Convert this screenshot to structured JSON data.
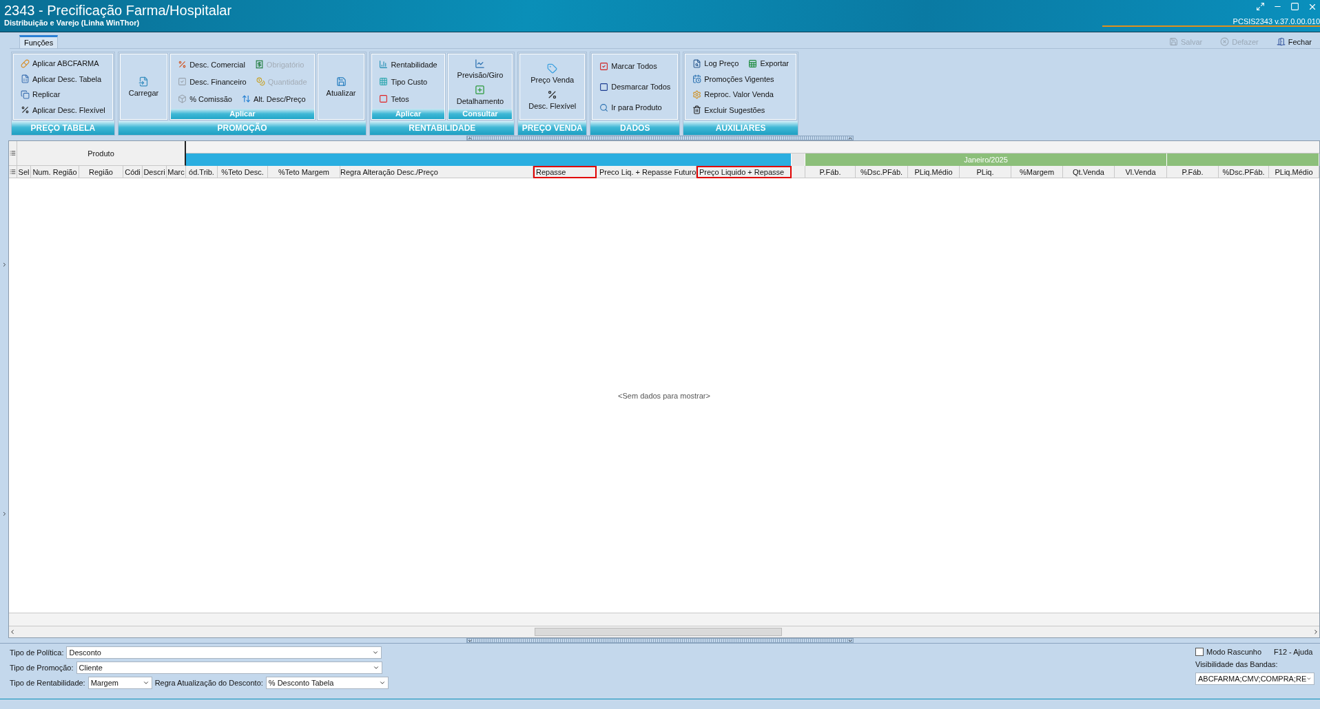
{
  "window": {
    "title": "2343 - Precificação Farma/Hospitalar",
    "subtitle": "Distribuição e Varejo (Linha WinThor)",
    "version": "PCSIS2343  v.37.0.00.010"
  },
  "toolbar": [
    {
      "label": "Salvar",
      "disabled": true
    },
    {
      "label": "Defazer",
      "disabled": true
    },
    {
      "label": "Fechar",
      "disabled": false
    }
  ],
  "ribbon": {
    "tabs": [
      {
        "label": "Funções",
        "selected": true
      }
    ],
    "groups": [
      {
        "title": "PREÇO TABELA",
        "panels": [
          {
            "kind": "small",
            "rows": [
              [
                {
                  "label": "Aplicar ABCFARMA",
                  "disabled": false
                }
              ],
              [
                {
                  "label": "Aplicar Desc. Tabela",
                  "disabled": false
                }
              ],
              [
                {
                  "label": "Replicar",
                  "disabled": false
                }
              ],
              [
                {
                  "label": "Aplicar Desc. Flexível",
                  "disabled": false
                }
              ]
            ]
          }
        ]
      },
      {
        "title": "PROMOÇÃO",
        "panels": [
          {
            "kind": "large",
            "rows": [
              [
                {
                  "label": "Carregar",
                  "disabled": false
                }
              ]
            ]
          },
          {
            "kind": "small",
            "caption": "Aplicar",
            "rows": [
              [
                {
                  "label": "Desc. Comercial",
                  "disabled": false
                },
                {
                  "label": "Obrigatório",
                  "disabled": true
                }
              ],
              [
                {
                  "label": "Desc. Financeiro",
                  "disabled": false
                },
                {
                  "label": "Quantidade",
                  "disabled": true
                }
              ],
              [
                {
                  "label": "% Comissão",
                  "disabled": false
                },
                {
                  "label": "Alt. Desc/Preço",
                  "disabled": false
                }
              ]
            ]
          },
          {
            "kind": "large",
            "rows": [
              [
                {
                  "label": "Atualizar",
                  "disabled": false
                }
              ]
            ]
          }
        ]
      },
      {
        "title": "RENTABILIDADE",
        "panels": [
          {
            "kind": "small",
            "caption": "Aplicar",
            "rows": [
              [
                {
                  "label": "Rentabilidade",
                  "disabled": false
                }
              ],
              [
                {
                  "label": "Tipo Custo",
                  "disabled": false
                }
              ],
              [
                {
                  "label": "Tetos",
                  "disabled": false
                }
              ]
            ]
          },
          {
            "kind": "large",
            "caption": "Consultar",
            "rows": [
              [
                {
                  "label": "Previsão/Giro",
                  "disabled": false
                }
              ],
              [
                {
                  "label": "Detalhamento",
                  "disabled": false
                }
              ]
            ]
          }
        ]
      },
      {
        "title": "PREÇO VENDA",
        "panels": [
          {
            "kind": "large",
            "rows": [
              [
                {
                  "label": "Preço Venda",
                  "disabled": false
                }
              ],
              [
                {
                  "label": "Desc. Flexível",
                  "disabled": false
                }
              ]
            ]
          }
        ]
      },
      {
        "title": "DADOS",
        "panels": [
          {
            "kind": "small",
            "rows": [
              [
                {
                  "label": "Marcar Todos",
                  "disabled": false
                }
              ],
              [
                {
                  "label": "Desmarcar Todos",
                  "disabled": false
                }
              ],
              [
                {
                  "label": "Ir para Produto",
                  "disabled": false
                }
              ]
            ]
          }
        ]
      },
      {
        "title": "AUXILIARES",
        "panels": [
          {
            "kind": "small",
            "rows": [
              [
                {
                  "label": "Log Preço",
                  "disabled": false
                },
                {
                  "label": "Exportar",
                  "disabled": false
                }
              ],
              [
                {
                  "label": "Promoções Vigentes",
                  "disabled": false
                }
              ],
              [
                {
                  "label": "Reproc. Valor Venda",
                  "disabled": false
                }
              ],
              [
                {
                  "label": "Excluir Sugestões",
                  "disabled": false
                }
              ]
            ]
          }
        ]
      }
    ]
  },
  "grid": {
    "group_header": "Produto",
    "bands": [
      {
        "color": "#2aaee0"
      },
      {
        "color": "#e6e6e6"
      },
      {
        "color": "#8cbf7a",
        "label": "Janeiro/2025"
      },
      {
        "color": "#8cbf7a"
      }
    ],
    "columns": [
      {
        "label": "Sel",
        "highlighted": false
      },
      {
        "label": "Num. Região",
        "highlighted": false
      },
      {
        "label": "Região",
        "highlighted": false
      },
      {
        "label": "Códi",
        "highlighted": false
      },
      {
        "label": "Descri",
        "highlighted": false
      },
      {
        "label": "Marc",
        "highlighted": false
      },
      {
        "label": "ód.Trib.",
        "highlighted": false
      },
      {
        "label": "%Teto Desc.",
        "highlighted": false
      },
      {
        "label": "%Teto Margem",
        "highlighted": false
      },
      {
        "label": "Regra Alteração Desc./Preço",
        "highlighted": false
      },
      {
        "label": "Repasse",
        "highlighted": true
      },
      {
        "label": "Preco Liq. + Repasse Futuro",
        "highlighted": false
      },
      {
        "label": "Preço Liquido + Repasse",
        "highlighted": true
      },
      {
        "highlighted": false
      },
      {
        "label": "P.Fáb.",
        "highlighted": false
      },
      {
        "label": "%Dsc.PFáb.",
        "highlighted": false
      },
      {
        "label": "PLiq.Médio",
        "highlighted": false
      },
      {
        "label": "PLiq.",
        "highlighted": false
      },
      {
        "label": "%Margem",
        "highlighted": false
      },
      {
        "label": "Qt.Venda",
        "highlighted": false
      },
      {
        "label": "Vl.Venda",
        "highlighted": false
      },
      {
        "label": "P.Fáb.",
        "highlighted": false
      },
      {
        "label": "%Dsc.PFáb.",
        "highlighted": false
      },
      {
        "label": "PLiq.Médio",
        "highlighted": false
      }
    ],
    "empty_message": "<Sem dados para mostrar>"
  },
  "filters": [
    {
      "label": "Tipo de Política:",
      "value": "Desconto"
    },
    {
      "label": "Tipo de Promoção:",
      "value": "Cliente"
    },
    {
      "label": "Tipo de Rentabilidade:",
      "value": "Margem"
    },
    {
      "label": "Regra Atualização do Desconto:",
      "value": "% Desconto Tabela"
    }
  ],
  "options": {
    "draft_mode": {
      "label": "Modo Rascunho",
      "checked": false
    },
    "help": "F12 - Ajuda",
    "bands_visibility": {
      "label": "Visibilidade das Bandas:",
      "value": "ABCFARMA;CMV;COMPRA;RE"
    }
  }
}
